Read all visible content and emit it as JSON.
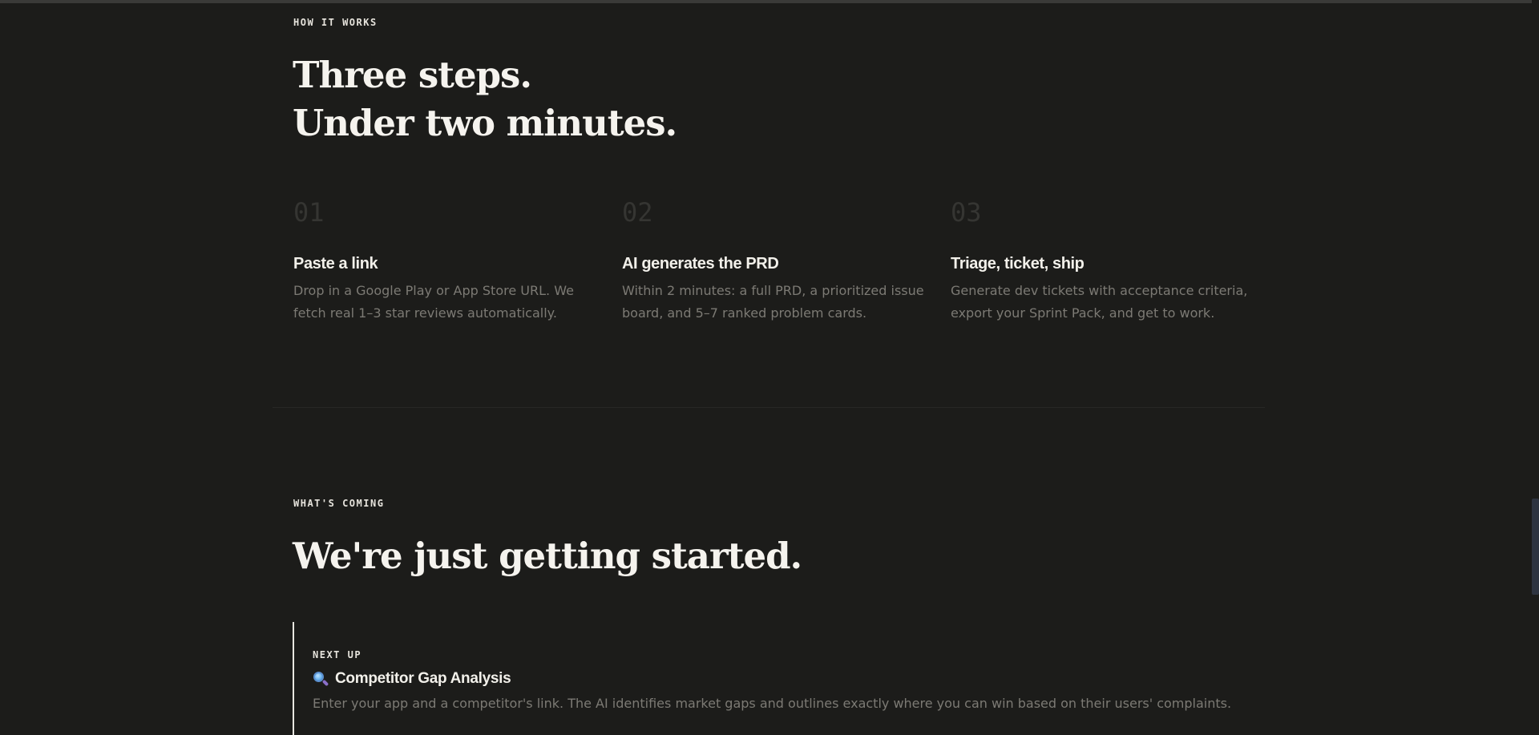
{
  "how_it_works": {
    "eyebrow": "HOW IT WORKS",
    "headline_line1": "Three steps.",
    "headline_line2": "Under two minutes."
  },
  "steps": [
    {
      "number": "01",
      "title": "Paste a link",
      "desc_line1": "Drop in a Google Play or App Store URL. We",
      "desc_line2": "fetch real 1–3 star reviews automatically."
    },
    {
      "number": "02",
      "title": "AI generates the PRD",
      "desc_line1": "Within 2 minutes: a full PRD, a prioritized issue",
      "desc_line2": "board, and 5–7 ranked problem cards."
    },
    {
      "number": "03",
      "title": "Triage, ticket, ship",
      "desc_line1": "Generate dev tickets with acceptance criteria,",
      "desc_line2": "export your Sprint Pack, and get to work."
    }
  ],
  "whats_coming": {
    "eyebrow": "WHAT'S COMING",
    "headline": "We're just getting started."
  },
  "next_up": {
    "eyebrow": "NEXT UP",
    "icon": "magnifying-glass-icon",
    "title": "Competitor Gap Analysis",
    "desc": "Enter your app and a competitor's link. The AI identifies market gaps and outlines exactly where you can win based on their users' complaints."
  },
  "colors": {
    "background": "#1c1c1a",
    "text": "#f2f0ea",
    "muted": "#7c7a74",
    "step_number": "#353532"
  }
}
